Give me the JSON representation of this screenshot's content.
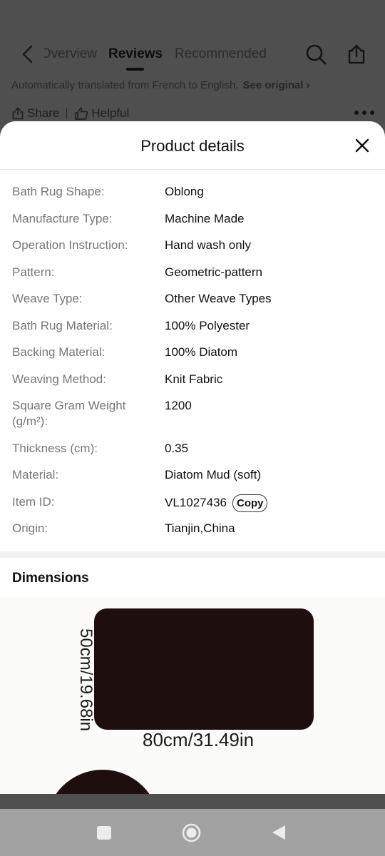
{
  "background": {
    "tabs": [
      "Overview",
      "Reviews",
      "Recommended"
    ],
    "translation_notice": "Automatically translated from French to English.",
    "see_original": "See original",
    "share_label": "Share",
    "helpful_label": "Helpful"
  },
  "sheet": {
    "title": "Product details",
    "details": [
      {
        "label": "Bath Rug Shape:",
        "value": "Oblong"
      },
      {
        "label": "Manufacture Type:",
        "value": "Machine Made"
      },
      {
        "label": "Operation Instruction:",
        "value": "Hand wash only"
      },
      {
        "label": "Pattern:",
        "value": "Geometric-pattern"
      },
      {
        "label": "Weave Type:",
        "value": "Other Weave Types"
      },
      {
        "label": "Bath Rug Material:",
        "value": "100% Polyester"
      },
      {
        "label": "Backing Material:",
        "value": "100% Diatom"
      },
      {
        "label": "Weaving Method:",
        "value": "Knit Fabric"
      },
      {
        "label": "Square Gram Weight (g/m²):",
        "value": "1200"
      },
      {
        "label": "Thickness (cm):",
        "value": "0.35"
      },
      {
        "label": "Material:",
        "value": "Diatom Mud (soft)"
      },
      {
        "label": "Item ID:",
        "value": "VL1027436"
      },
      {
        "label": "Origin:",
        "value": "Tianjin,China"
      }
    ],
    "copy_label": "Copy",
    "dimensions_title": "Dimensions",
    "dimension_height": "50cm/19.68in",
    "dimension_width": "80cm/31.49in"
  },
  "colors": {
    "overlay": "#4f4f4f",
    "rug": "#1e0f0e",
    "navbar": "#a2a2a2"
  }
}
